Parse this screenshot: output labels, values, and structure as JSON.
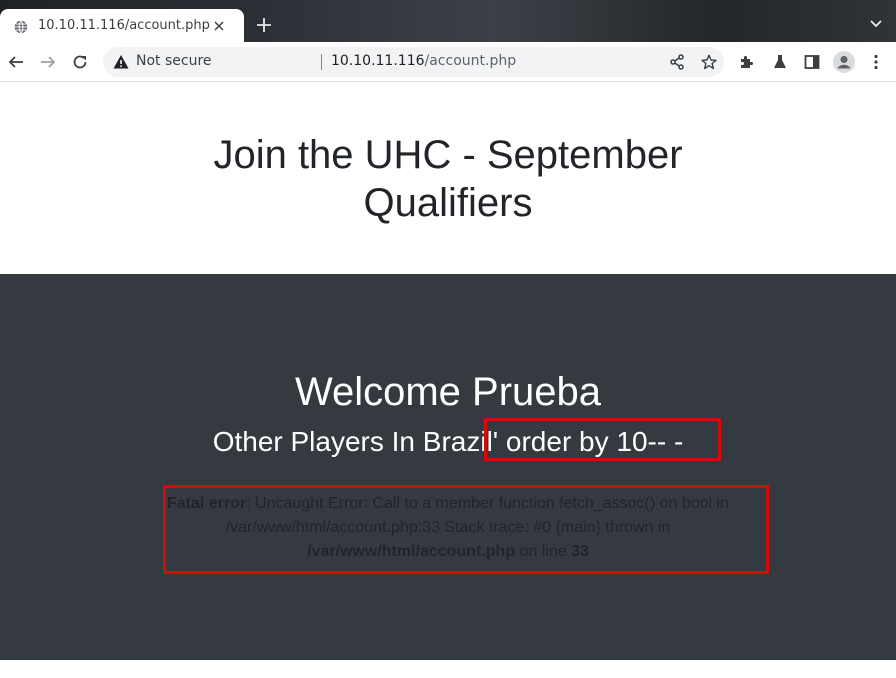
{
  "browser": {
    "tab": {
      "title": "10.10.11.116/account.php"
    },
    "omnibox": {
      "security_label": "Not secure",
      "url_host": "10.10.11.116",
      "url_path": "/account.php"
    },
    "icons": [
      "globe-icon",
      "close-icon",
      "plus-icon",
      "chevron-down-icon",
      "back-arrow-icon",
      "forward-arrow-icon",
      "reload-icon",
      "warning-icon",
      "share-icon",
      "star-icon",
      "puzzle-icon",
      "flask-icon",
      "side-panel-icon",
      "profile-icon",
      "kebab-menu-icon"
    ],
    "colors": {
      "tabstrip": "#2b3136",
      "warning": "#202124"
    }
  },
  "page": {
    "heading": "Join the UHC - September Qualifiers",
    "welcome": "Welcome Prueba",
    "players_prefix": "Other Players In Brazi",
    "players_suffix": "l' order by 10-- -",
    "error": {
      "label": "Fatal error",
      "message": ": Uncaught Error: Call to a member function fetch_assoc() on bool in /var/www/html/account.php:33 Stack trace: #0 {main} thrown in ",
      "file": "/var/www/html/account.php",
      "on_line": " on line ",
      "line": "33"
    },
    "colors": {
      "section_dark": "#343a40",
      "highlight_box": "#d40b0b"
    }
  }
}
